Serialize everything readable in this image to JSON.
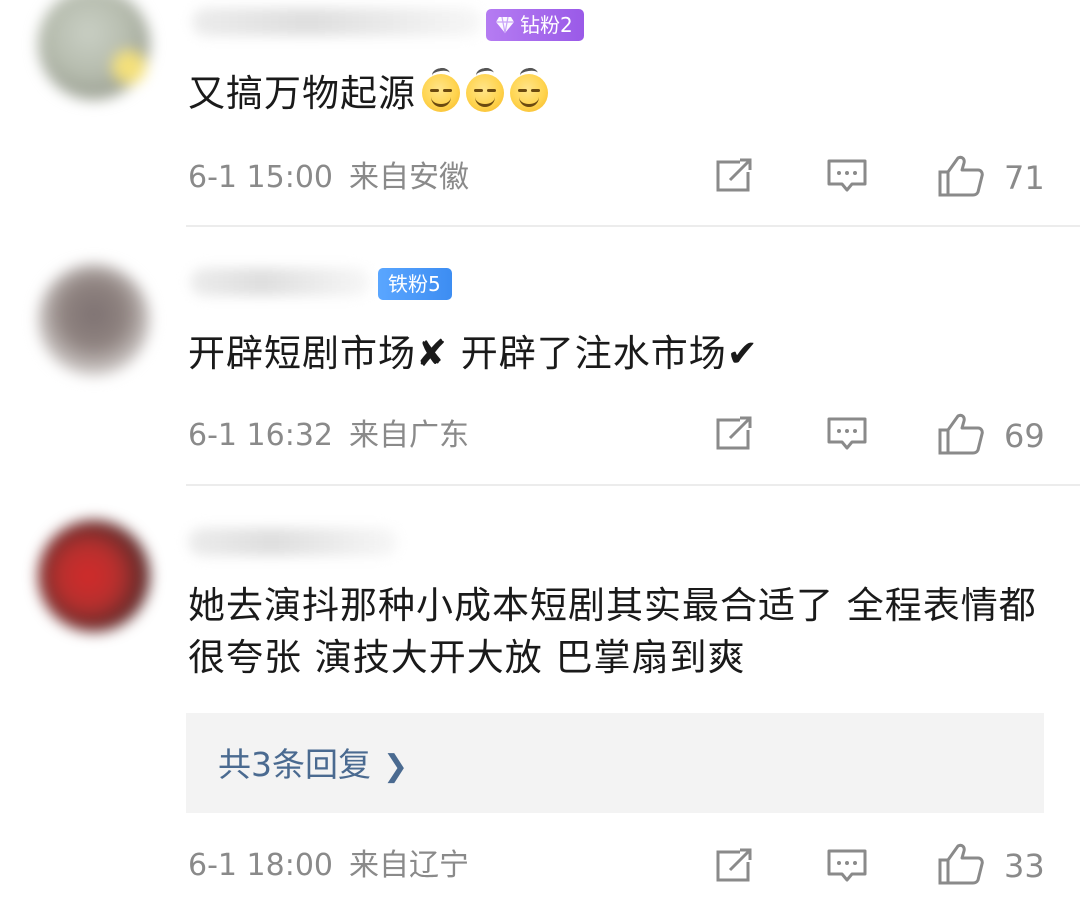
{
  "comments": [
    {
      "badge": "钻粉2",
      "badge_color": "#a66bee",
      "text": "又搞万物起源",
      "emojis": [
        "grin-sweat-emoji",
        "grin-sweat-emoji",
        "grin-sweat-emoji"
      ],
      "time": "6-1 15:00",
      "location": "来自安徽",
      "likes": "71"
    },
    {
      "badge": "铁粉5",
      "badge_color": "#4b97f7",
      "text": "开辟短剧市场✘  开辟了注水市场✔",
      "time": "6-1 16:32",
      "location": "来自广东",
      "likes": "69"
    },
    {
      "text": "她去演抖那种小成本短剧其实最合适了 全程表情都很夸张 演技大开大放 巴掌扇到爽",
      "replies_link": "共3条回复",
      "time": "6-1 18:00",
      "location": "来自辽宁",
      "likes": "33"
    }
  ],
  "colors": {
    "text": "#1a1a1a",
    "meta": "#8a8a8a",
    "reply_link": "#4a6a90",
    "reply_box_bg": "#f3f3f3"
  },
  "icons": {
    "share": "share-icon",
    "reply": "reply-icon",
    "like": "thumbs-up-icon",
    "chevron": "chevron-right-icon",
    "gem": "diamond-icon"
  }
}
